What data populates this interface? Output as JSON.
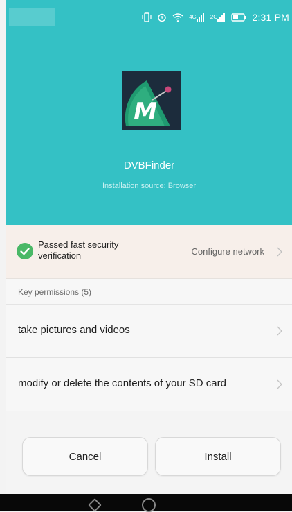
{
  "status_bar": {
    "network_a": "4G",
    "network_b": "2G",
    "time": "2:31 PM"
  },
  "app": {
    "name": "DVBFinder",
    "source": "Installation source: Browser",
    "icon_letter": "M",
    "icon_name": "dvbfinder-logo"
  },
  "verification": {
    "text": "Passed fast security verification",
    "action": "Configure network"
  },
  "permissions": {
    "header": "Key permissions (5)",
    "items": [
      {
        "label": "take pictures and videos"
      },
      {
        "label": "modify or delete the contents of your SD card"
      }
    ]
  },
  "buttons": {
    "cancel": "Cancel",
    "install": "Install"
  },
  "colors": {
    "header_bg": "#34c1c5",
    "success_green": "#4ab867",
    "verify_bg": "#f7efea"
  }
}
